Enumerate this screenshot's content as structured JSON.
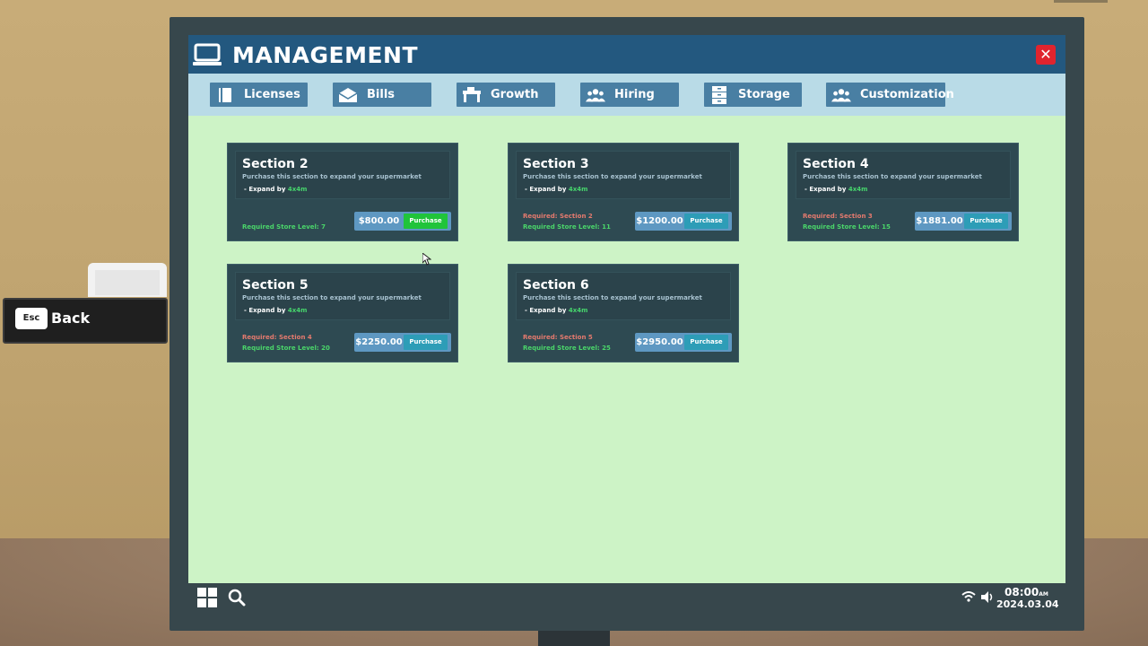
{
  "window": {
    "title": "MANAGEMENT",
    "close_label": "✕"
  },
  "tabs": [
    {
      "label": "Licenses",
      "icon": "book-icon"
    },
    {
      "label": "Bills",
      "icon": "envelope-icon"
    },
    {
      "label": "Growth",
      "icon": "desk-icon"
    },
    {
      "label": "Hiring",
      "icon": "people-icon"
    },
    {
      "label": "Storage",
      "icon": "cabinet-icon"
    },
    {
      "label": "Customization",
      "icon": "people-icon"
    }
  ],
  "sections": [
    {
      "title": "Section 2",
      "description": "Purchase this section to expand your supermarket",
      "expand_prefix": "- Expand by ",
      "expand_value": "4x4m",
      "required_section": "",
      "required_level": "Required Store Level: 7",
      "price": "$800.00",
      "button": "Purchase"
    },
    {
      "title": "Section 3",
      "description": "Purchase this section to expand your supermarket",
      "expand_prefix": "- Expand by ",
      "expand_value": "4x4m",
      "required_section": "Required: Section 2",
      "required_level": "Required Store Level: 11",
      "price": "$1200.00",
      "button": "Purchase"
    },
    {
      "title": "Section 4",
      "description": "Purchase this section to expand your supermarket",
      "expand_prefix": "- Expand by ",
      "expand_value": "4x4m",
      "required_section": "Required: Section 3",
      "required_level": "Required Store Level: 15",
      "price": "$1881.00",
      "button": "Purchase"
    },
    {
      "title": "Section 5",
      "description": "Purchase this section to expand your supermarket",
      "expand_prefix": "- Expand by ",
      "expand_value": "4x4m",
      "required_section": "Required: Section 4",
      "required_level": "Required Store Level: 20",
      "price": "$2250.00",
      "button": "Purchase"
    },
    {
      "title": "Section 6",
      "description": "Purchase this section to expand your supermarket",
      "expand_prefix": "- Expand by ",
      "expand_value": "4x4m",
      "required_section": "Required: Section 5",
      "required_level": "Required Store Level: 25",
      "price": "$2950.00",
      "button": "Purchase"
    }
  ],
  "taskbar": {
    "time": "08:00",
    "ampm": "AM",
    "date": "2024.03.04"
  },
  "back_hint": {
    "key": "Esc",
    "label": "Back"
  },
  "colors": {
    "title_bar": "#23587f",
    "screen_bg": "#cdf3c6",
    "purchase_active": "#20c43a",
    "purchase": "#2d9db7",
    "close": "#e0242e"
  }
}
